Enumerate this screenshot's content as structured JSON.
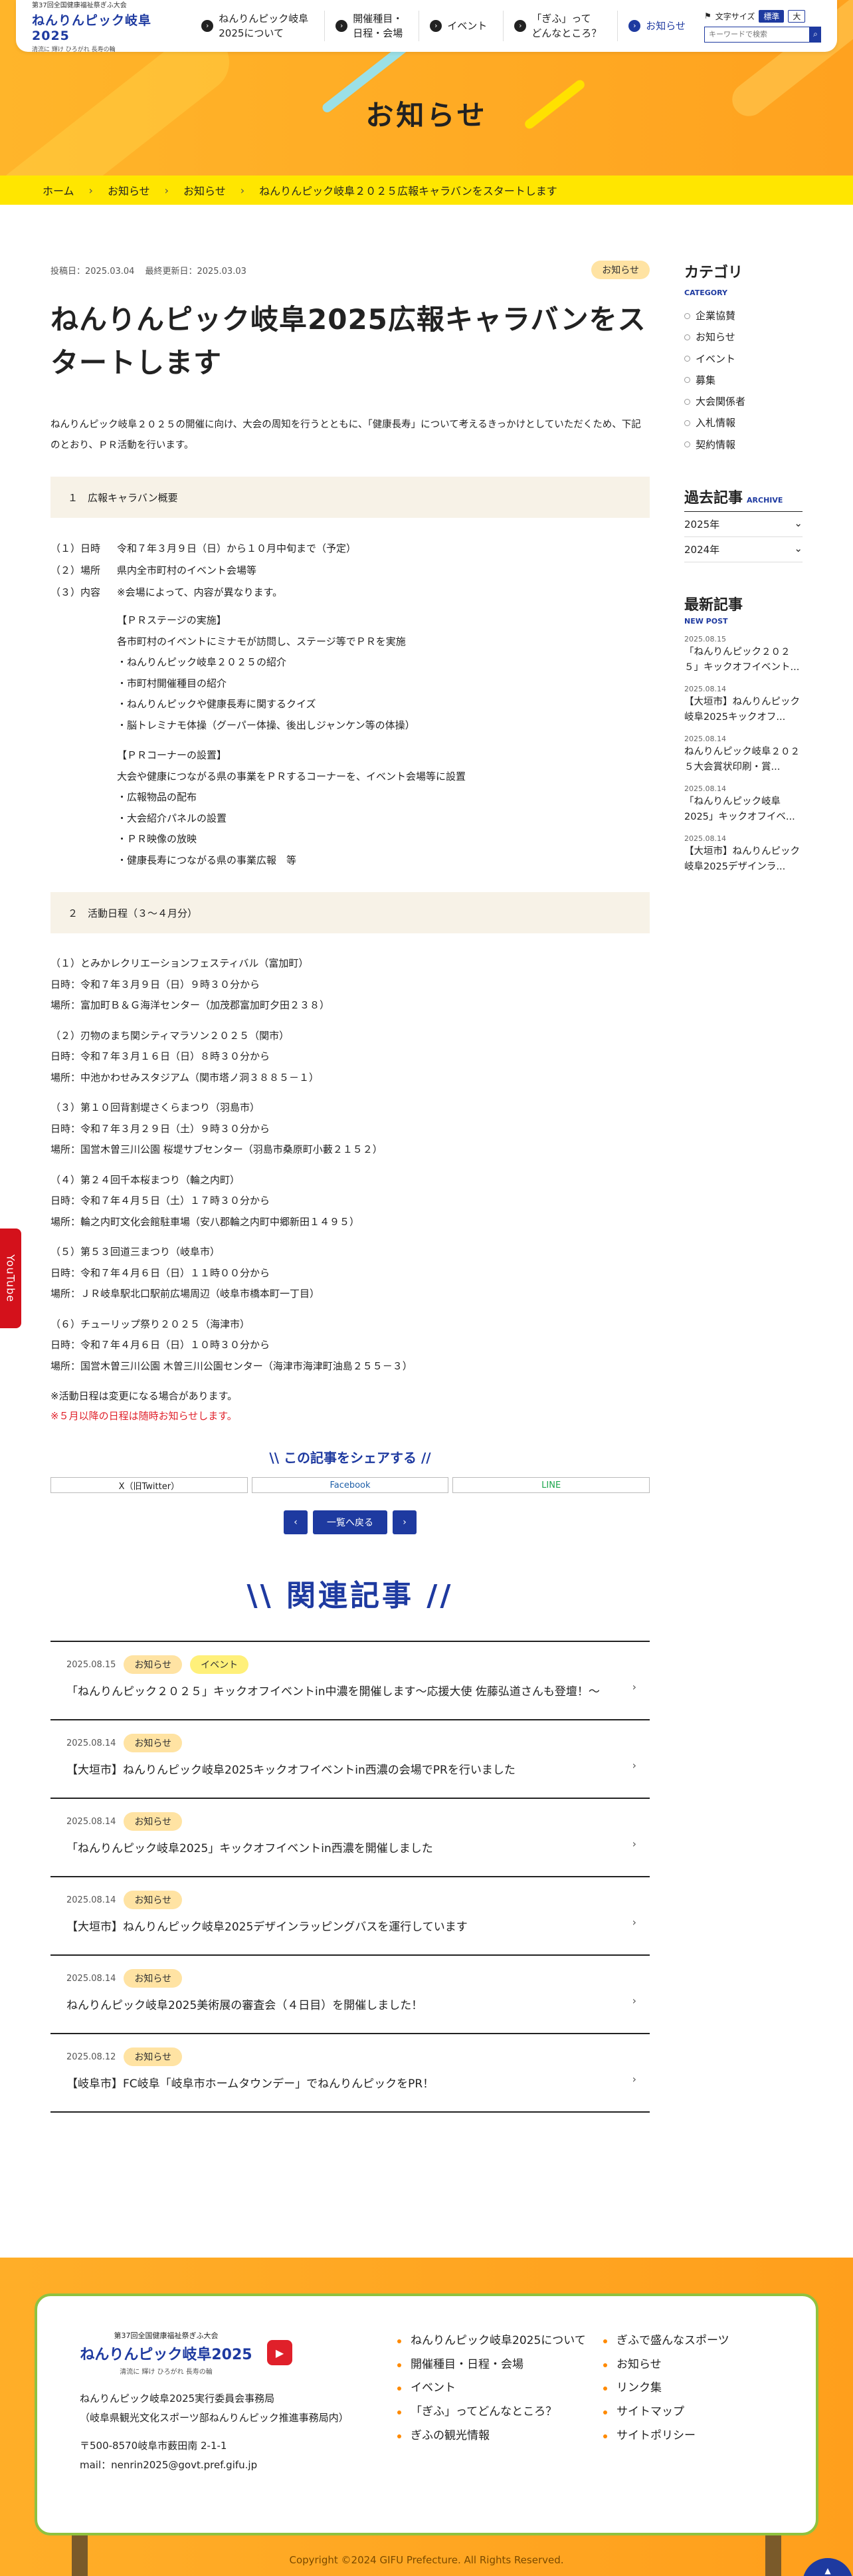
{
  "header": {
    "logo": {
      "line1": "第37回全国健康福祉祭ぎふ大会",
      "line2": "ねんりんピック岐阜2025",
      "line3": "清流に 輝け ひろがれ 長寿の輪"
    },
    "nav": [
      {
        "label_a": "ねんりんピック岐阜",
        "label_b": "2025について"
      },
      {
        "label_a": "開催種目・",
        "label_b": "日程・会場"
      },
      {
        "label_a": "イベント",
        "label_b": ""
      },
      {
        "label_a": "「ぎふ」って",
        "label_b": "どんなところ？"
      },
      {
        "label_a": "お知らせ",
        "label_b": ""
      }
    ],
    "font_size_label": "文字サイズ",
    "font_std": "標準",
    "font_large": "大",
    "search_placeholder": "キーワードで検索"
  },
  "hero": {
    "title": "お知らせ"
  },
  "breadcrumb": [
    "ホーム",
    "お知らせ",
    "お知らせ",
    "ねんりんピック岐阜２０２５広報キャラバンをスタートします"
  ],
  "article": {
    "posted": "投稿日：2025.03.04",
    "updated": "最終更新日：2025.03.03",
    "category": "お知らせ",
    "title": "ねんりんピック岐阜2025広報キャラバンをスタートします",
    "lead": "ねんりんピック岐阜２０２５の開催に向け、大会の周知を行うとともに、「健康長寿」について考えるきっかけとしていただくため、下記のとおり、ＰＲ活動を行います。",
    "sec1": "１　広報キャラバン概要",
    "rows": [
      {
        "k": "（１）日時",
        "v": "令和７年３月９日（日）から１０月中旬まで（予定）"
      },
      {
        "k": "（２）場所",
        "v": "県内全市町村のイベント会場等"
      },
      {
        "k": "（３）内容",
        "v": "※会場によって、内容が異なります。"
      }
    ],
    "stage": [
      "【ＰＲステージの実施】",
      "各市町村のイベントにミナモが訪問し、ステージ等でＰＲを実施",
      "・ねんりんピック岐阜２０２５の紹介",
      "・市町村開催種目の紹介",
      "・ねんりんピックや健康長寿に関するクイズ",
      "・脳トレミナモ体操（グーパー体操、後出しジャンケン等の体操）"
    ],
    "corner": [
      "【ＰＲコーナーの設置】",
      "大会や健康につながる県の事業をＰＲするコーナーを、イベント会場等に設置",
      "・広報物品の配布",
      "・大会紹介パネルの設置",
      "・ＰＲ映像の放映",
      "・健康長寿につながる県の事業広報　等"
    ],
    "sec2": "２　活動日程（３～４月分）",
    "schedule": [
      {
        "n": "（１）とみかレクリエーションフェスティバル（富加町）",
        "d": "日時：令和７年３月９日（日）９時３０分から",
        "p": "場所：富加町Ｂ＆Ｇ海洋センター（加茂郡富加町夕田２３８）"
      },
      {
        "n": "（２）刃物のまち関シティマラソン２０２５（関市）",
        "d": "日時：令和７年３月１６日（日）８時３０分から",
        "p": "場所：中池かわせみスタジアム（関市塔ノ洞３８８５－１）"
      },
      {
        "n": "（３）第１０回背割堤さくらまつり（羽島市）",
        "d": "日時：令和７年３月２９日（土）９時３０分から",
        "p": "場所：国営木曽三川公園 桜堤サブセンター（羽島市桑原町小藪２１５２）"
      },
      {
        "n": "（４）第２４回千本桜まつり（輪之内町）",
        "d": "日時：令和７年４月５日（土）１７時３０分から",
        "p": "場所：輪之内町文化会館駐車場（安八郡輪之内町中郷新田１４９５）"
      },
      {
        "n": "（５）第５３回道三まつり（岐阜市）",
        "d": "日時：令和７年４月６日（日）１１時００分から",
        "p": "場所：ＪＲ岐阜駅北口駅前広場周辺（岐阜市橋本町一丁目）"
      },
      {
        "n": "（６）チューリップ祭り２０２５（海津市）",
        "d": "日時：令和７年４月６日（日）１０時３０分から",
        "p": "場所：国営木曽三川公園 木曽三川公園センター（海津市海津町油島２５５－３）"
      }
    ],
    "note1": "※活動日程は変更になる場合があります。",
    "note2": "※５月以降の日程は随時お知らせします。"
  },
  "share": {
    "title": "\\\\ この記事をシェアする //",
    "x": "X（旧Twitter）",
    "fb": "Facebook",
    "line": "LINE"
  },
  "pager": {
    "prev": "‹",
    "list": "一覧へ戻る",
    "next": "›"
  },
  "related": {
    "title": "\\\\ 関連記事 //",
    "items": [
      {
        "date": "2025.08.15",
        "cat": "お知らせ",
        "cat2": "イベント",
        "title": "「ねんりんピック２０２５」キックオフイベントin中濃を開催します～応援大使 佐藤弘道さんも登壇！～"
      },
      {
        "date": "2025.08.14",
        "cat": "お知らせ",
        "cat2": "",
        "title": "【大垣市】ねんりんピック岐阜2025キックオフイベントin西濃の会場でPRを行いました"
      },
      {
        "date": "2025.08.14",
        "cat": "お知らせ",
        "cat2": "",
        "title": "「ねんりんピック岐阜2025」キックオフイベントin西濃を開催しました"
      },
      {
        "date": "2025.08.14",
        "cat": "お知らせ",
        "cat2": "",
        "title": "【大垣市】ねんりんピック岐阜2025デザインラッピングバスを運行しています"
      },
      {
        "date": "2025.08.14",
        "cat": "お知らせ",
        "cat2": "",
        "title": "ねんりんピック岐阜2025美術展の審査会（４日目）を開催しました！"
      },
      {
        "date": "2025.08.12",
        "cat": "お知らせ",
        "cat2": "",
        "title": "【岐阜市】FC岐阜「岐阜市ホームタウンデー」でねんりんピックをPR！"
      }
    ]
  },
  "sidebar": {
    "cat_title": "カテゴリ",
    "cat_en": "CATEGORY",
    "cats": [
      "企業協賛",
      "お知らせ",
      "イベント",
      "募集",
      "大会関係者",
      "入札情報",
      "契約情報"
    ],
    "arch_title": "過去記事",
    "arch_en": "ARCHIVE",
    "years": [
      "2025年",
      "2024年"
    ],
    "latest_title": "最新記事",
    "latest_en": "NEW POST",
    "latest": [
      {
        "d": "2025.08.15",
        "t": "「ねんりんピック２０２５」キックオフイベント..."
      },
      {
        "d": "2025.08.14",
        "t": "【大垣市】ねんりんピック岐阜2025キックオフ..."
      },
      {
        "d": "2025.08.14",
        "t": "ねんりんピック岐阜２０２５大会賞状印刷・賞..."
      },
      {
        "d": "2025.08.14",
        "t": "「ねんりんピック岐阜2025」キックオフイベ..."
      },
      {
        "d": "2025.08.14",
        "t": "【大垣市】ねんりんピック岐阜2025デザインラ..."
      }
    ]
  },
  "youtube_tab": "YouTube",
  "footer": {
    "org1": "ねんりんピック岐阜2025実行委員会事務局",
    "org2": "（岐阜県観光文化スポーツ部ねんりんピック推進事務局内）",
    "addr": "〒500-8570岐阜市薮田南 2-1-1",
    "mail": "mail：nenrin2025@govt.pref.gifu.jp",
    "nav1": [
      "ねんりんピック岐阜2025について",
      "開催種目・日程・会場",
      "イベント",
      "「ぎふ」ってどんなところ？",
      "ぎふの観光情報"
    ],
    "nav2": [
      "ぎふで盛んなスポーツ",
      "お知らせ",
      "リンク集",
      "サイトマップ",
      "サイトポリシー"
    ],
    "copyright": "Copyright ©2024 GIFU Prefecture. All Rights Reserved.",
    "pagetop": "▲"
  },
  "colors": {
    "accent": "#1e3aa0",
    "orange": "#ffa21f",
    "yellow": "#ffe600",
    "red": "#e0202a"
  }
}
